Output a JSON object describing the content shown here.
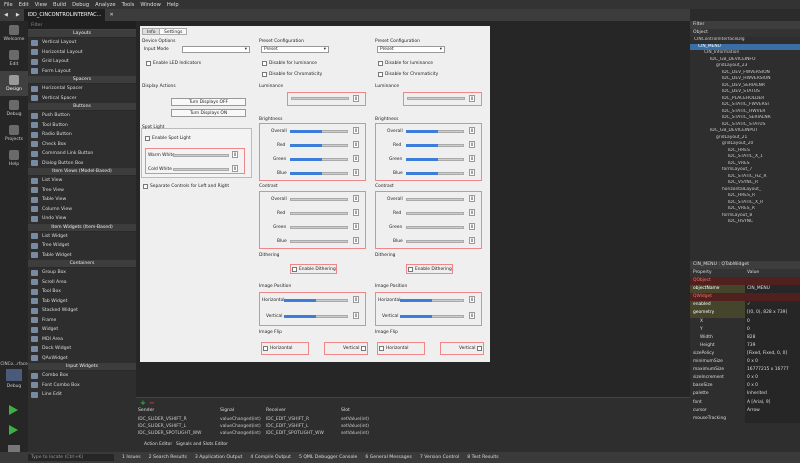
{
  "menu": [
    "File",
    "Edit",
    "View",
    "Build",
    "Debug",
    "Analyze",
    "Tools",
    "Window",
    "Help"
  ],
  "editor_tab": "IDD_CINCONTROLINTERFAC...",
  "modes": [
    {
      "label": "Welcome",
      "icon": "grid-icon"
    },
    {
      "label": "Edit",
      "icon": "edit-icon"
    },
    {
      "label": "Design",
      "icon": "pencil-icon"
    },
    {
      "label": "Debug",
      "icon": "bug-icon"
    },
    {
      "label": "Projects",
      "icon": "wrench-icon"
    },
    {
      "label": "Help",
      "icon": "question-icon"
    }
  ],
  "bottom_modes": {
    "project": "CINCo...rface",
    "build": "Debug"
  },
  "widgetbox": {
    "filter_placeholder": "Filter",
    "categories": [
      {
        "name": "Layouts",
        "items": [
          "Vertical Layout",
          "Horizontal Layout",
          "Grid Layout",
          "Form Layout"
        ]
      },
      {
        "name": "Spacers",
        "items": [
          "Horizontal Spacer",
          "Vertical Spacer"
        ]
      },
      {
        "name": "Buttons",
        "items": [
          "Push Button",
          "Tool Button",
          "Radio Button",
          "Check Box",
          "Command Link Button",
          "Dialog Button Box"
        ]
      },
      {
        "name": "Item Views (Model-Based)",
        "items": [
          "List View",
          "Tree View",
          "Table View",
          "Column View",
          "Undo View"
        ]
      },
      {
        "name": "Item Widgets (Item-Based)",
        "items": [
          "List Widget",
          "Tree Widget",
          "Table Widget"
        ]
      },
      {
        "name": "Containers",
        "items": [
          "Group Box",
          "Scroll Area",
          "Tool Box",
          "Tab Widget",
          "Stacked Widget",
          "Frame",
          "Widget",
          "MDI Area",
          "Dock Widget",
          "QAxWidget"
        ]
      },
      {
        "name": "Input Widgets",
        "items": [
          "Combo Box",
          "Font Combo Box",
          "Line Edit"
        ]
      }
    ]
  },
  "form": {
    "tabs": [
      "Info",
      "Settings"
    ],
    "device_options": {
      "title": "Device Options",
      "input_mode": "Input Mode",
      "enable_led": "Enable LED Indicators"
    },
    "display_actions": {
      "title": "Display Actions",
      "off": "Turn Displays OFF",
      "on": "Turn Displays ON"
    },
    "spot_light": {
      "title": "Spot Light",
      "enable": "Enable Spot Light",
      "warm": "Warm White",
      "cold": "Cold White",
      "warm_value": "0",
      "cold_value": "0"
    },
    "separate": "Separate Controls for Left and Right",
    "columns": [
      {
        "preset_title": "Preset Configuration",
        "preset": "Preset",
        "lum_check": "Disable for luminance",
        "chrom_check": "Disable for Chromaticity",
        "luminance": "Luminance",
        "lum_value": "0",
        "brightness": "Brightness",
        "contrast": "Contrast",
        "channels": [
          "Overall",
          "Red",
          "Green",
          "Blue"
        ],
        "values": [
          "0",
          "0",
          "0",
          "0"
        ],
        "dithering": "Dithering",
        "enable_dithering": "Enable Dithering",
        "image_position": "Image Position",
        "horizontal": "Horizontal",
        "vertical": "Vertical",
        "pos_values": [
          "0",
          "0"
        ],
        "image_flip": "Image Flip",
        "flip_h": "Horizontal",
        "flip_v": "Vertical"
      },
      {
        "preset_title": "Preset Configuration",
        "preset": "Preset",
        "lum_check": "Disable for luminance",
        "chrom_check": "Disable for Chromaticity",
        "luminance": "Luminance",
        "lum_value": "0",
        "brightness": "Brightness",
        "contrast": "Contrast",
        "channels": [
          "Overall",
          "Red",
          "Green",
          "Blue"
        ],
        "values": [
          "0",
          "0",
          "0",
          "0"
        ],
        "dithering": "Dithering",
        "enable_dithering": "Enable Dithering",
        "image_position": "Image Position",
        "horizontal": "Horizontal",
        "vertical": "Vertical",
        "pos_values": [
          "0",
          "0"
        ],
        "image_flip": "Image Flip",
        "flip_h": "Horizontal",
        "flip_v": "Vertical"
      }
    ]
  },
  "sigslot": {
    "headers": [
      "Sender",
      "Signal",
      "Receiver",
      "Slot"
    ],
    "rows": [
      [
        "IDC_SLIDER_VSHIFT_R",
        "valueChanged(int)",
        "IDC_EDIT_VSHIFT_R",
        "setValue(int)"
      ],
      [
        "IDC_SLIDER_VSHIFT_L",
        "valueChanged(int)",
        "IDC_EDIT_VSHIFT_L",
        "setValue(int)"
      ],
      [
        "IDC_SLIDER_SPOTLIGHT_WW",
        "valueChanged(int)",
        "IDC_EDIT_SPOTLIGHT_WW",
        "setValue(int)"
      ]
    ],
    "tabs": [
      "Action Editor",
      "Signals and Slots Editor"
    ]
  },
  "object_inspector": {
    "filter": "Filter",
    "header": "Object",
    "rows": [
      "CINControlInterfaceDlg",
      "CIN_MENU",
      "CIN_Information",
      "IDC_GB_DEVICEINFO",
      "gridLayout_23",
      "IDC_DEV_FWVERSION",
      "IDC_DEV_HWVERSION",
      "IDC_DEV_SERIALNR",
      "IDC_DEV_STATUS",
      "IDC_PLACEHOLDER",
      "IDC_STATIC_FWVERSI",
      "IDC_STATIC_HWVER",
      "IDC_STATIC_SERIALNR",
      "IDC_STATIC_STATUS",
      "IDC_GB_DEVICEINPUT",
      "gridLayout_21",
      "gridLayout_20",
      "IDC_HRES",
      "IDC_STATIC_X_1",
      "IDC_VRES",
      "formLayout_7",
      "IDC_STATIC_HZ_R",
      "IDC_VSYNC_R",
      "horizontalLayout_",
      "IDC_HRES_R",
      "IDC_STATIC_X_R",
      "IDC_VRES_R",
      "formLayout_8",
      "IDC_HSYNC"
    ]
  },
  "property_editor": {
    "filter_title": "CIN_MENU : QTabWidget",
    "headers": [
      "Property",
      "Value"
    ],
    "rows": [
      {
        "k": "QObject",
        "v": "",
        "group": true
      },
      {
        "k": "objectName",
        "v": "CIN_MENU"
      },
      {
        "k": "QWidget",
        "v": "",
        "group": true
      },
      {
        "k": "enabled",
        "v": "✓"
      },
      {
        "k": "geometry",
        "v": "[(0, 0), 828 x 739]"
      },
      {
        "k": "X",
        "v": "0"
      },
      {
        "k": "Y",
        "v": "0"
      },
      {
        "k": "Width",
        "v": "828"
      },
      {
        "k": "Height",
        "v": "739"
      },
      {
        "k": "sizePolicy",
        "v": "[Fixed, Fixed, 0, 0]"
      },
      {
        "k": "minimumSize",
        "v": "0 x 0"
      },
      {
        "k": "maximumSize",
        "v": "16777215 x 16777"
      },
      {
        "k": "sizeIncrement",
        "v": "0 x 0"
      },
      {
        "k": "baseSize",
        "v": "0 x 0"
      },
      {
        "k": "palette",
        "v": "Inherited"
      },
      {
        "k": "font",
        "v": "A [Arial, 9]"
      },
      {
        "k": "cursor",
        "v": "Arrow"
      },
      {
        "k": "mouseTracking",
        "v": ""
      }
    ]
  },
  "statusbar": {
    "locate_placeholder": "Type to locate (Ctrl+K)",
    "items": [
      "1 Issues",
      "2 Search Results",
      "3 Application Output",
      "4 Compile Output",
      "5 QML Debugger Console",
      "6 General Messages",
      "7 Version Control",
      "8 Test Results"
    ]
  }
}
